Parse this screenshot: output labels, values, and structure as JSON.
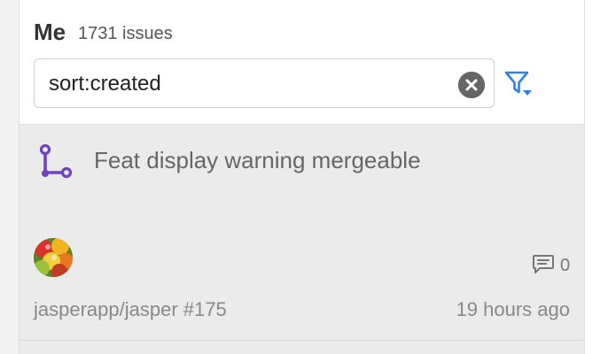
{
  "stream": {
    "title": "Me",
    "count_label": "1731 issues"
  },
  "search": {
    "value": "sort:created",
    "placeholder": "",
    "clear_icon": "clear-x-circle-icon"
  },
  "filter": {
    "icon": "filter-dropdown-icon",
    "color": "#2f80ed"
  },
  "issues": [
    {
      "type_icon": "git-pull-request-icon",
      "type_color": "#6f42c1",
      "title": "Feat display warning mergeable",
      "avatar": "user-avatar",
      "comment_icon": "comment-icon",
      "comment_count": "0",
      "repo_label": "jasperapp/jasper #175",
      "time_label": "19 hours ago"
    }
  ]
}
